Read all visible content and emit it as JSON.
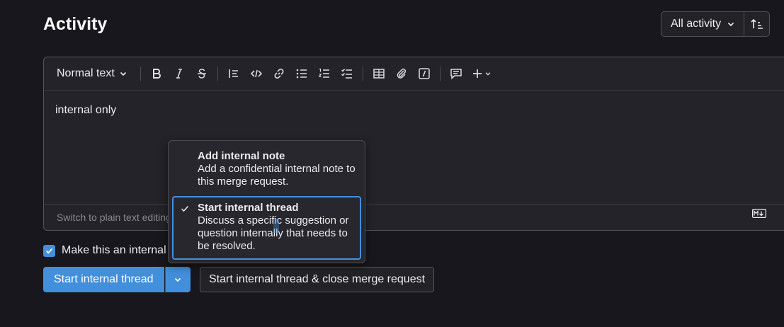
{
  "header": {
    "title": "Activity",
    "filter_label": "All activity"
  },
  "toolbar": {
    "text_style": "Normal text",
    "icons": [
      "bold-icon",
      "italic-icon",
      "strikethrough-icon",
      "blockquote-icon",
      "code-icon",
      "link-icon",
      "bullet-list-icon",
      "numbered-list-icon",
      "task-list-icon",
      "table-icon",
      "attach-icon",
      "slash-command-icon",
      "comment-icon",
      "plus-icon"
    ]
  },
  "editor": {
    "content": "internal only",
    "footer_text": "Switch to plain text editing",
    "markdown_badge": "M↓"
  },
  "dropdown": {
    "items": [
      {
        "title": "Add internal note",
        "desc": "Add a confidential internal note to this merge request.",
        "selected": false
      },
      {
        "title": "Start internal thread",
        "desc": "Discuss a specific suggestion or question internally that needs to be resolved.",
        "selected": true
      }
    ]
  },
  "footer": {
    "checkbox_label": "Make this an internal note",
    "primary_button": "Start internal thread",
    "secondary_button": "Start internal thread & close merge request"
  },
  "colors": {
    "background": "#18171d",
    "accent": "#428fdc",
    "panel": "#242329"
  }
}
